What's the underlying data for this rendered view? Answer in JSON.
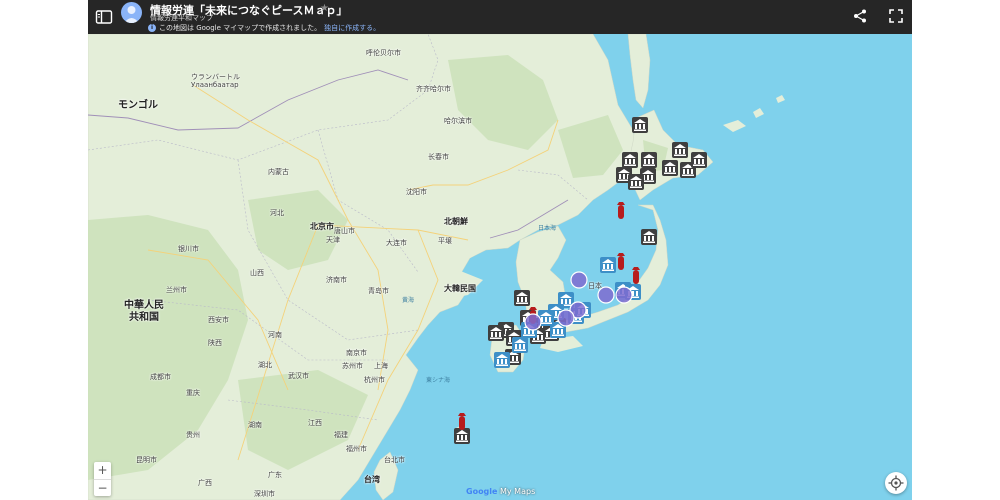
{
  "topbar": {
    "title": "情報労連「未来につなぐピースＭａｐ」",
    "subtitle": "情報労連平和マップ",
    "notice_text": "この地図は Google マイマップで作成されました。",
    "notice_link": "独自に作成する。",
    "info_glyph": "i"
  },
  "labels": {
    "mongolia": "モンゴル",
    "ulaanbaatar_ja": "ウランバートル",
    "ulaanbaatar_mn": "Улаанбаатар",
    "hulunbuir": "呼伦贝尔市",
    "qiqihar": "齐齐哈尔市",
    "harbin": "哈尔滨市",
    "changchun": "长春市",
    "inner_mongolia": "内蒙古",
    "shenyang": "沈阳市",
    "hebei": "河北",
    "beijing": "北京市",
    "tangshan": "唐山市",
    "tianjin": "天津",
    "dalian": "大连市",
    "north_korea": "北朝鮮",
    "pyongyang": "平壌",
    "sea_of_japan": "日本海",
    "yinchuan": "银川市",
    "lanzhou": "兰州市",
    "china": "中華人民\n共和国",
    "jinan": "济南市",
    "qingdao": "青岛市",
    "yellow_sea": "黄海",
    "south_korea": "大韓民国",
    "xian": "西安市",
    "nanjing": "南京市",
    "suzhou": "苏州市",
    "shanghai": "上海",
    "hangzhou": "杭州市",
    "east_china_sea": "東シナ海",
    "chengdu": "成都市",
    "wuhan": "武汉市",
    "chongqing": "重庆",
    "kunming": "昆明市",
    "fuzhou": "福州市",
    "taipei": "台北市",
    "taiwan": "台湾",
    "shenzhen": "深圳市",
    "japan": "日本",
    "henan": "河南",
    "shanxi": "山西",
    "shaanxi": "陕西",
    "hubei": "湖北",
    "hunan": "湖南",
    "jiangxi": "江西",
    "guizhou": "贵州",
    "guangxi": "广西",
    "guangdong": "广东",
    "fujian": "福建"
  },
  "controls": {
    "zoom_in": "+",
    "zoom_out": "−"
  },
  "attribution": {
    "google": "Google",
    "mymaps": "My Maps"
  },
  "colors": {
    "sea": "#7fd1ec",
    "land": "#e3eed8",
    "topbar": "#262626",
    "marker_museum": "#3f3f3f",
    "marker_museum_blue": "#3d8fc7",
    "marker_bomb": "#b71c1c",
    "marker_circle": "#7e6cd0"
  },
  "markers": {
    "museum_dark_count": 22,
    "museum_blue_count": 12,
    "bomb_red_count": 5,
    "circle_purple_count": 6
  }
}
